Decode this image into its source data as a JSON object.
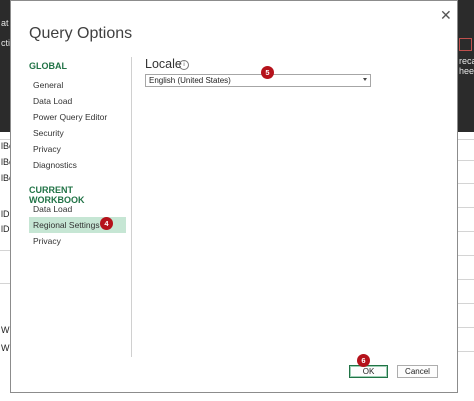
{
  "dialog": {
    "title": "Query Options",
    "close_symbol": "✕"
  },
  "nav": {
    "global_header": "GLOBAL",
    "global_items": [
      "General",
      "Data Load",
      "Power Query Editor",
      "Security",
      "Privacy",
      "Diagnostics"
    ],
    "workbook_header": "CURRENT WORKBOOK",
    "workbook_items": [
      "Data Load",
      "Regional Settings",
      "Privacy"
    ],
    "selected": "Regional Settings"
  },
  "locale": {
    "label": "Locale",
    "info_symbol": "i",
    "value": "English (United States)"
  },
  "badges": {
    "regional": "4",
    "locale": "5",
    "ok": "6"
  },
  "buttons": {
    "ok": "OK",
    "cancel": "Cancel"
  },
  "background": {
    "fragments_top": [
      "at",
      "cti"
    ],
    "fragments_right": [
      "recast",
      "heet"
    ],
    "fragments_left": [
      "lBo",
      "lBo",
      "lBo",
      "lDi",
      "lDi",
      "W",
      "W"
    ]
  },
  "colors": {
    "accent": "#217346",
    "selected_bg": "#c6e6d4",
    "badge": "#b5121b"
  }
}
